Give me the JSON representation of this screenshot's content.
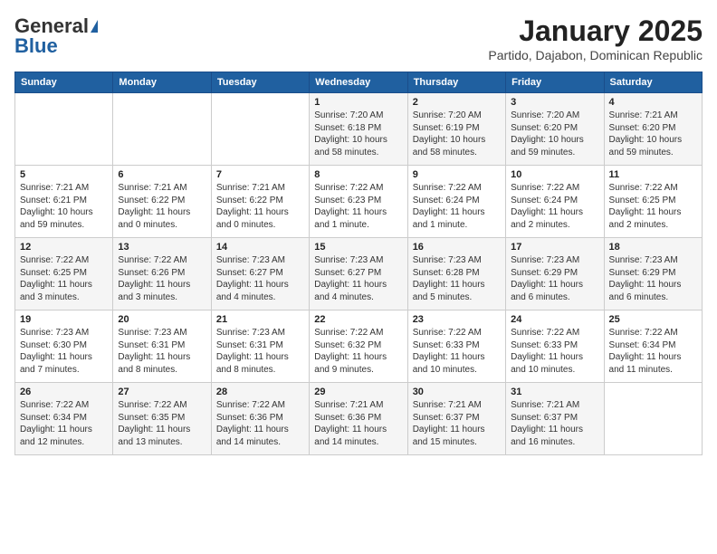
{
  "logo": {
    "general": "General",
    "blue": "Blue"
  },
  "header": {
    "month": "January 2025",
    "location": "Partido, Dajabon, Dominican Republic"
  },
  "days_of_week": [
    "Sunday",
    "Monday",
    "Tuesday",
    "Wednesday",
    "Thursday",
    "Friday",
    "Saturday"
  ],
  "weeks": [
    [
      {
        "day": "",
        "info": ""
      },
      {
        "day": "",
        "info": ""
      },
      {
        "day": "",
        "info": ""
      },
      {
        "day": "1",
        "info": "Sunrise: 7:20 AM\nSunset: 6:18 PM\nDaylight: 10 hours and 58 minutes."
      },
      {
        "day": "2",
        "info": "Sunrise: 7:20 AM\nSunset: 6:19 PM\nDaylight: 10 hours and 58 minutes."
      },
      {
        "day": "3",
        "info": "Sunrise: 7:20 AM\nSunset: 6:20 PM\nDaylight: 10 hours and 59 minutes."
      },
      {
        "day": "4",
        "info": "Sunrise: 7:21 AM\nSunset: 6:20 PM\nDaylight: 10 hours and 59 minutes."
      }
    ],
    [
      {
        "day": "5",
        "info": "Sunrise: 7:21 AM\nSunset: 6:21 PM\nDaylight: 10 hours and 59 minutes."
      },
      {
        "day": "6",
        "info": "Sunrise: 7:21 AM\nSunset: 6:22 PM\nDaylight: 11 hours and 0 minutes."
      },
      {
        "day": "7",
        "info": "Sunrise: 7:21 AM\nSunset: 6:22 PM\nDaylight: 11 hours and 0 minutes."
      },
      {
        "day": "8",
        "info": "Sunrise: 7:22 AM\nSunset: 6:23 PM\nDaylight: 11 hours and 1 minute."
      },
      {
        "day": "9",
        "info": "Sunrise: 7:22 AM\nSunset: 6:24 PM\nDaylight: 11 hours and 1 minute."
      },
      {
        "day": "10",
        "info": "Sunrise: 7:22 AM\nSunset: 6:24 PM\nDaylight: 11 hours and 2 minutes."
      },
      {
        "day": "11",
        "info": "Sunrise: 7:22 AM\nSunset: 6:25 PM\nDaylight: 11 hours and 2 minutes."
      }
    ],
    [
      {
        "day": "12",
        "info": "Sunrise: 7:22 AM\nSunset: 6:25 PM\nDaylight: 11 hours and 3 minutes."
      },
      {
        "day": "13",
        "info": "Sunrise: 7:22 AM\nSunset: 6:26 PM\nDaylight: 11 hours and 3 minutes."
      },
      {
        "day": "14",
        "info": "Sunrise: 7:23 AM\nSunset: 6:27 PM\nDaylight: 11 hours and 4 minutes."
      },
      {
        "day": "15",
        "info": "Sunrise: 7:23 AM\nSunset: 6:27 PM\nDaylight: 11 hours and 4 minutes."
      },
      {
        "day": "16",
        "info": "Sunrise: 7:23 AM\nSunset: 6:28 PM\nDaylight: 11 hours and 5 minutes."
      },
      {
        "day": "17",
        "info": "Sunrise: 7:23 AM\nSunset: 6:29 PM\nDaylight: 11 hours and 6 minutes."
      },
      {
        "day": "18",
        "info": "Sunrise: 7:23 AM\nSunset: 6:29 PM\nDaylight: 11 hours and 6 minutes."
      }
    ],
    [
      {
        "day": "19",
        "info": "Sunrise: 7:23 AM\nSunset: 6:30 PM\nDaylight: 11 hours and 7 minutes."
      },
      {
        "day": "20",
        "info": "Sunrise: 7:23 AM\nSunset: 6:31 PM\nDaylight: 11 hours and 8 minutes."
      },
      {
        "day": "21",
        "info": "Sunrise: 7:23 AM\nSunset: 6:31 PM\nDaylight: 11 hours and 8 minutes."
      },
      {
        "day": "22",
        "info": "Sunrise: 7:22 AM\nSunset: 6:32 PM\nDaylight: 11 hours and 9 minutes."
      },
      {
        "day": "23",
        "info": "Sunrise: 7:22 AM\nSunset: 6:33 PM\nDaylight: 11 hours and 10 minutes."
      },
      {
        "day": "24",
        "info": "Sunrise: 7:22 AM\nSunset: 6:33 PM\nDaylight: 11 hours and 10 minutes."
      },
      {
        "day": "25",
        "info": "Sunrise: 7:22 AM\nSunset: 6:34 PM\nDaylight: 11 hours and 11 minutes."
      }
    ],
    [
      {
        "day": "26",
        "info": "Sunrise: 7:22 AM\nSunset: 6:34 PM\nDaylight: 11 hours and 12 minutes."
      },
      {
        "day": "27",
        "info": "Sunrise: 7:22 AM\nSunset: 6:35 PM\nDaylight: 11 hours and 13 minutes."
      },
      {
        "day": "28",
        "info": "Sunrise: 7:22 AM\nSunset: 6:36 PM\nDaylight: 11 hours and 14 minutes."
      },
      {
        "day": "29",
        "info": "Sunrise: 7:21 AM\nSunset: 6:36 PM\nDaylight: 11 hours and 14 minutes."
      },
      {
        "day": "30",
        "info": "Sunrise: 7:21 AM\nSunset: 6:37 PM\nDaylight: 11 hours and 15 minutes."
      },
      {
        "day": "31",
        "info": "Sunrise: 7:21 AM\nSunset: 6:37 PM\nDaylight: 11 hours and 16 minutes."
      },
      {
        "day": "",
        "info": ""
      }
    ]
  ]
}
